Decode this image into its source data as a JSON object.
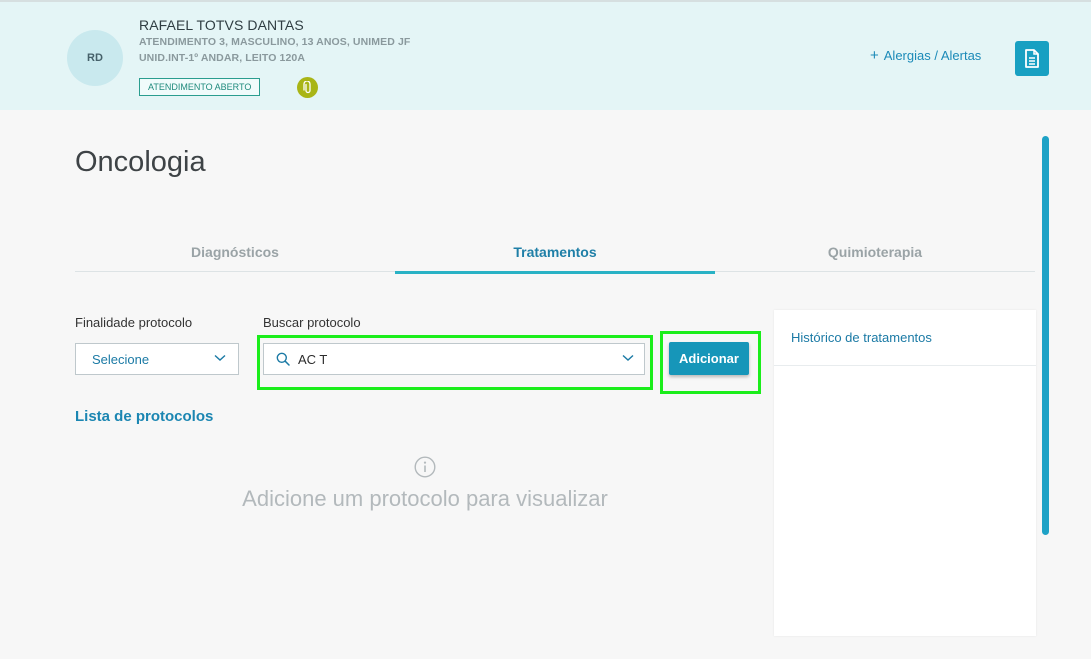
{
  "patient": {
    "initials": "RD",
    "name": "RAFAEL TOTVS DANTAS",
    "details_line1": "ATENDIMENTO 3, MASCULINO, 13 ANOS, UNIMED JF",
    "details_line2": "UNID.INT-1º ANDAR, LEITO 120A",
    "status": "ATENDIMENTO ABERTO",
    "clip_icon": "paperclip-icon"
  },
  "header": {
    "alerts_plus": "+",
    "alerts_label": "Alergias / Alertas",
    "doc_icon": "document-icon"
  },
  "page": {
    "title": "Oncologia"
  },
  "tabs": [
    {
      "label": "Diagnósticos",
      "active": false
    },
    {
      "label": "Tratamentos",
      "active": true
    },
    {
      "label": "Quimioterapia",
      "active": false
    }
  ],
  "form": {
    "finalidade_label": "Finalidade protocolo",
    "finalidade_value": "Selecione",
    "buscar_label": "Buscar protocolo",
    "buscar_value": "AC T",
    "add_button": "Adicionar"
  },
  "list": {
    "title": "Lista de protocolos",
    "empty_message": "Adicione um protocolo para visualizar"
  },
  "history": {
    "title": "Histórico de tratamentos"
  },
  "colors": {
    "header_bg": "#e4f5f6",
    "accent": "#1696b9",
    "tab_indicator": "#29b2c5",
    "highlight": "#1bee1b",
    "clip_badge": "#a9b516"
  }
}
